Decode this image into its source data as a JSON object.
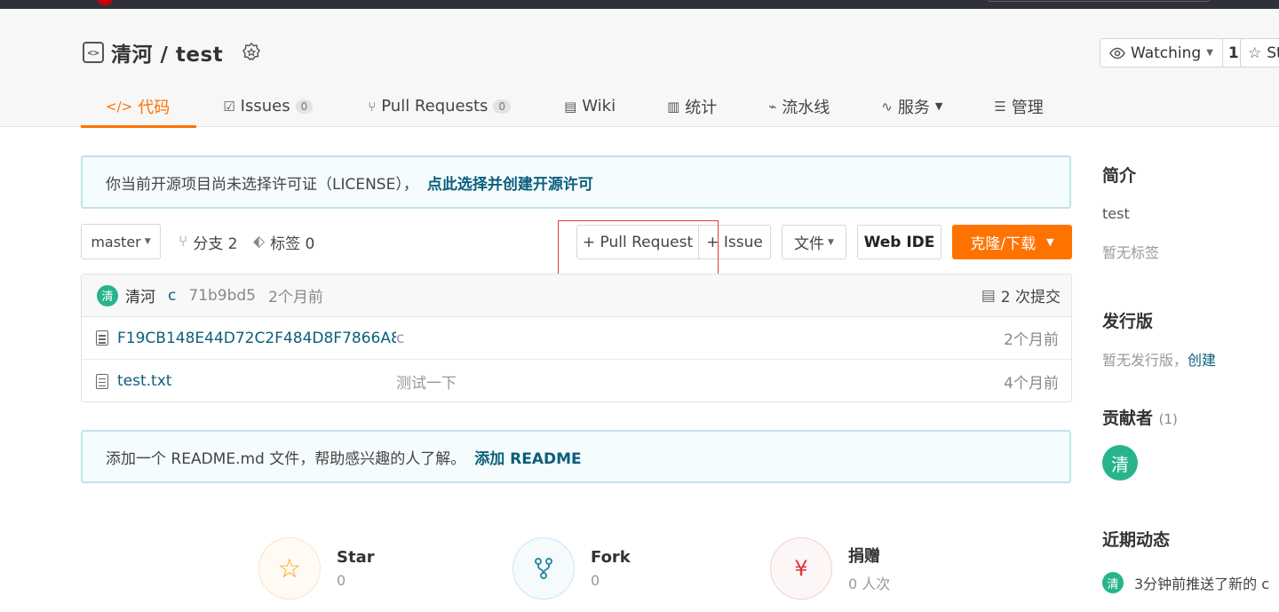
{
  "repo": {
    "title": "清河 / test",
    "watch_label": "Watching",
    "watch_count": "1",
    "star_label": "St"
  },
  "tabs": [
    {
      "label": "代码",
      "icon": "code-icon"
    },
    {
      "label": "Issues",
      "count": "0",
      "icon": "issues-icon"
    },
    {
      "label": "Pull Requests",
      "count": "0",
      "icon": "pull-request-icon"
    },
    {
      "label": "Wiki",
      "icon": "book-icon"
    },
    {
      "label": "统计",
      "icon": "bar-chart-icon"
    },
    {
      "label": "流水线",
      "icon": "pipeline-icon"
    },
    {
      "label": "服务",
      "icon": "pulse-icon"
    },
    {
      "label": "管理",
      "icon": "settings-doc-icon"
    }
  ],
  "license_notice": {
    "text": "你当前开源项目尚未选择许可证（LICENSE），",
    "link": "点此选择并创建开源许可"
  },
  "toolbar": {
    "branch": "master",
    "branches": "分支 2",
    "tags": "标签 0",
    "pull_request": "+ Pull Request",
    "issue": "+ Issue",
    "file": "文件",
    "web_ide": "Web IDE",
    "clone": "克隆/下载"
  },
  "commit": {
    "avatar": "清",
    "author": "清河",
    "message": "c",
    "sha": "71b9bd5",
    "time": "2个月前",
    "total": "2 次提交"
  },
  "files": [
    {
      "name": "F19CB148E44D72C2F484D8F7866A84...",
      "message": "c",
      "time": "2个月前"
    },
    {
      "name": "test.txt",
      "message": "测试一下",
      "time": "4个月前"
    }
  ],
  "readme_notice": {
    "text": "添加一个 README.md 文件，帮助感兴趣的人了解。",
    "link": "添加 README"
  },
  "stats": [
    {
      "label": "Star",
      "value": "0"
    },
    {
      "label": "Fork",
      "value": "0"
    },
    {
      "label": "捐赠",
      "value": "0 人次"
    }
  ],
  "sidebar": {
    "intro_title": "简介",
    "intro_text": "test",
    "no_tags": "暂无标签",
    "release_title": "发行版",
    "no_release": "暂无发行版，",
    "create": "创建",
    "contrib_title": "贡献者",
    "contrib_count": "(1)",
    "contrib_avatar": "清",
    "activity_title": "近期动态",
    "activity_avatar": "清",
    "activity_text": "3分钟前推送了新的 c"
  },
  "colors": {
    "accent": "#fe7300",
    "link": "#0b5e7c",
    "avatar": "#27b48c"
  }
}
